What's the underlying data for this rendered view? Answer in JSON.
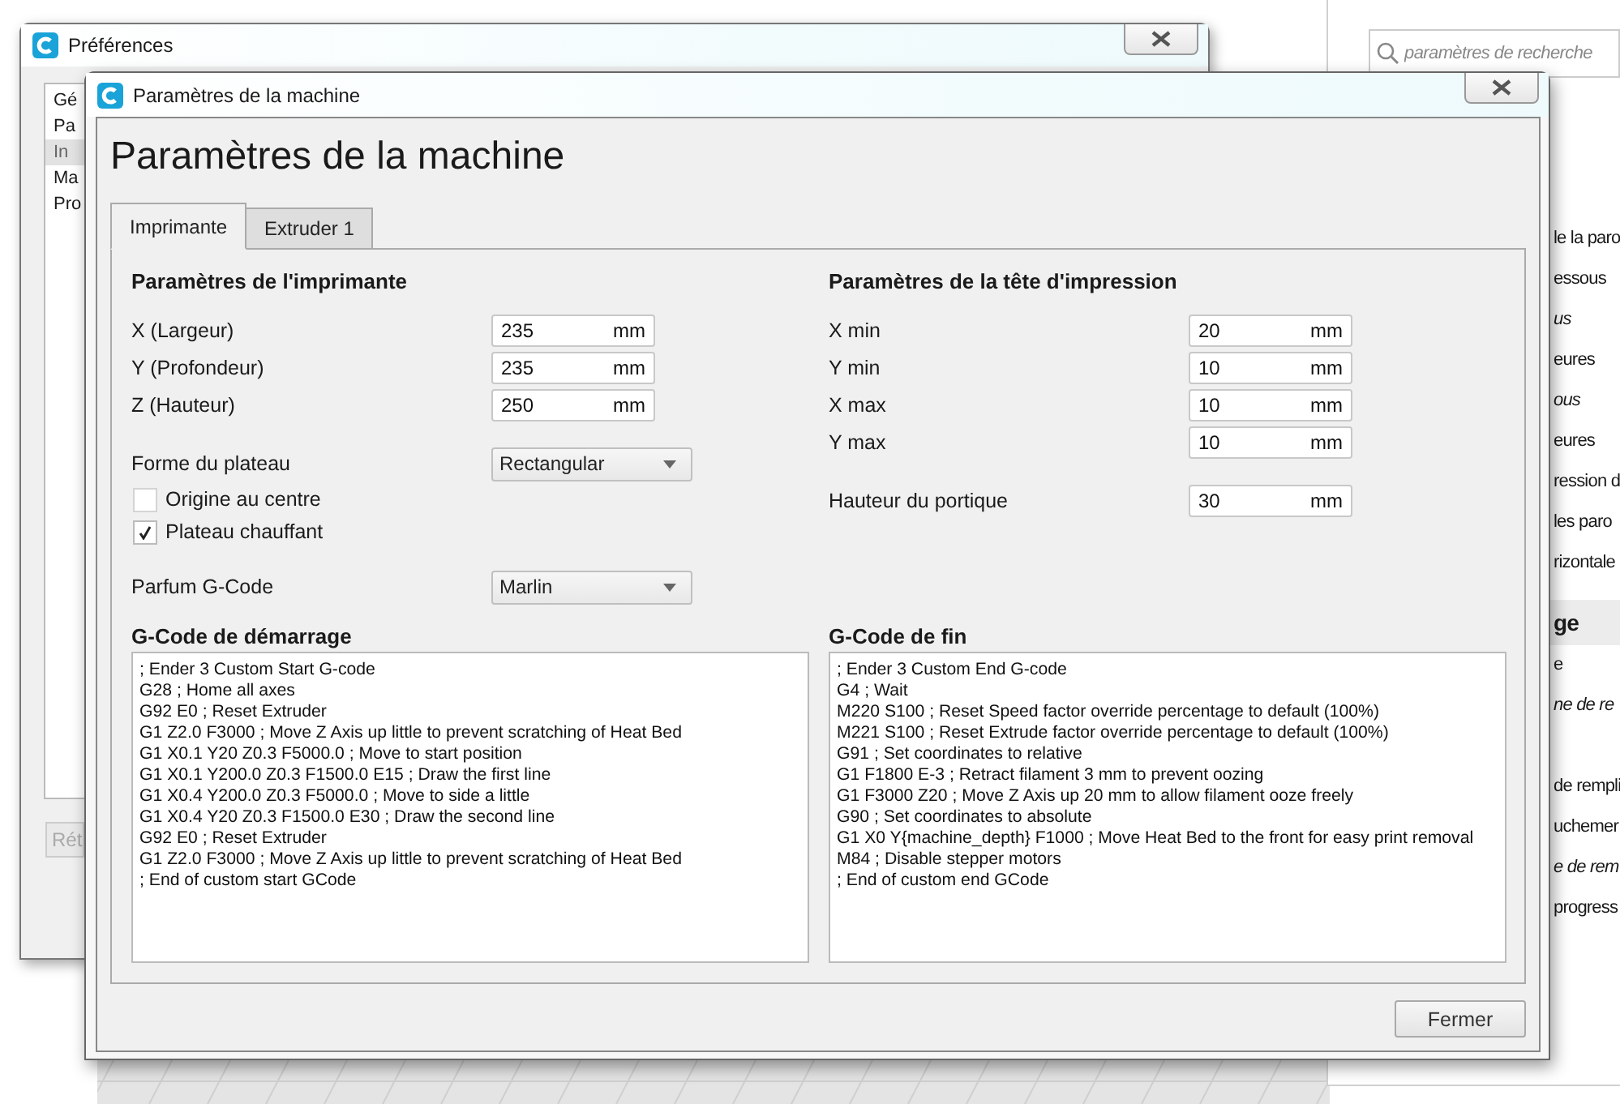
{
  "settings_panel": {
    "search": {
      "placeholder": "paramètres de recherche"
    },
    "items": [
      {
        "kind": "item",
        "text": "le la paro",
        "italic": false
      },
      {
        "kind": "item",
        "text": "essous",
        "italic": false
      },
      {
        "kind": "item",
        "text": "us",
        "italic": true
      },
      {
        "kind": "item",
        "text": "eures",
        "italic": false
      },
      {
        "kind": "item",
        "text": "ous",
        "italic": true
      },
      {
        "kind": "item",
        "text": "eures",
        "italic": false
      },
      {
        "kind": "item",
        "text": "ression d",
        "italic": false
      },
      {
        "kind": "item",
        "text": "les paro",
        "italic": false
      },
      {
        "kind": "item",
        "text": "rizontale",
        "italic": false
      },
      {
        "kind": "header",
        "text": "ge",
        "italic": false
      },
      {
        "kind": "item",
        "text": "e",
        "italic": false
      },
      {
        "kind": "item",
        "text": "ne de re",
        "italic": true
      },
      {
        "kind": "gap"
      },
      {
        "kind": "item",
        "text": "de rempli",
        "italic": false
      },
      {
        "kind": "item",
        "text": "uchemer",
        "italic": false
      },
      {
        "kind": "item",
        "text": "e de rem",
        "italic": true
      },
      {
        "kind": "item",
        "text": "progress",
        "italic": false
      }
    ]
  },
  "preferences_window": {
    "title": "Préférences",
    "sidebar": {
      "items": [
        {
          "label": "Gé",
          "selected": false
        },
        {
          "label": "Pa",
          "selected": false
        },
        {
          "label": "In",
          "selected": true
        },
        {
          "label": "Ma",
          "selected": false
        },
        {
          "label": "Pro",
          "selected": false
        }
      ]
    },
    "button": "Rét"
  },
  "machine_dialog": {
    "title": "Paramètres de la machine",
    "heading": "Paramètres de la machine",
    "tabs": [
      {
        "label": "Imprimante",
        "selected": true
      },
      {
        "label": "Extruder 1",
        "selected": false
      }
    ],
    "printer_settings": {
      "title": "Paramètres de l'imprimante",
      "fields": [
        {
          "label": "X (Largeur)",
          "value": "235",
          "unit": "mm"
        },
        {
          "label": "Y (Profondeur)",
          "value": "235",
          "unit": "mm"
        },
        {
          "label": "Z (Hauteur)",
          "value": "250",
          "unit": "mm"
        }
      ],
      "build_plate_shape": {
        "label": "Forme du plateau",
        "value": "Rectangular"
      },
      "checkboxes": [
        {
          "label": "Origine au centre",
          "checked": false
        },
        {
          "label": "Plateau chauffant",
          "checked": true
        }
      ],
      "gcode_flavor": {
        "label": "Parfum G-Code",
        "value": "Marlin"
      }
    },
    "head_settings": {
      "title": "Paramètres de la tête d'impression",
      "fields": [
        {
          "label": "X min",
          "value": "20",
          "unit": "mm"
        },
        {
          "label": "Y min",
          "value": "10",
          "unit": "mm"
        },
        {
          "label": "X max",
          "value": "10",
          "unit": "mm"
        },
        {
          "label": "Y max",
          "value": "10",
          "unit": "mm"
        }
      ],
      "gantry_height": {
        "label": "Hauteur du portique",
        "value": "30",
        "unit": "mm"
      }
    },
    "start_gcode": {
      "title": "G-Code de démarrage",
      "lines": [
        "; Ender 3 Custom Start G-code",
        "G28 ; Home all axes",
        "G92 E0 ; Reset Extruder",
        "G1 Z2.0 F3000 ; Move Z Axis up little to prevent scratching of Heat Bed",
        "G1 X0.1 Y20 Z0.3 F5000.0 ; Move to start position",
        "G1 X0.1 Y200.0 Z0.3 F1500.0 E15 ; Draw the first line",
        "G1 X0.4 Y200.0 Z0.3 F5000.0 ; Move to side a little",
        "G1 X0.4 Y20 Z0.3 F1500.0 E30 ; Draw the second line",
        "G92 E0 ; Reset Extruder",
        "G1 Z2.0 F3000 ; Move Z Axis up little to prevent scratching of Heat Bed",
        "; End of custom start GCode"
      ]
    },
    "end_gcode": {
      "title": "G-Code de fin",
      "lines": [
        "; Ender 3 Custom End G-code",
        "G4 ; Wait",
        "M220 S100 ; Reset Speed factor override percentage to default (100%)",
        "M221 S100 ; Reset Extrude factor override percentage to default (100%)",
        "G91 ; Set coordinates to relative",
        "G1 F1800 E-3 ; Retract filament 3 mm to prevent oozing",
        "G1 F3000 Z20 ; Move Z Axis up 20 mm to allow filament ooze freely",
        "G90 ; Set coordinates to absolute",
        "G1 X0 Y{machine_depth} F1000 ; Move Heat Bed to the front for easy print removal",
        "M84 ; Disable stepper motors",
        "; End of custom end GCode"
      ]
    },
    "close_button": "Fermer"
  }
}
